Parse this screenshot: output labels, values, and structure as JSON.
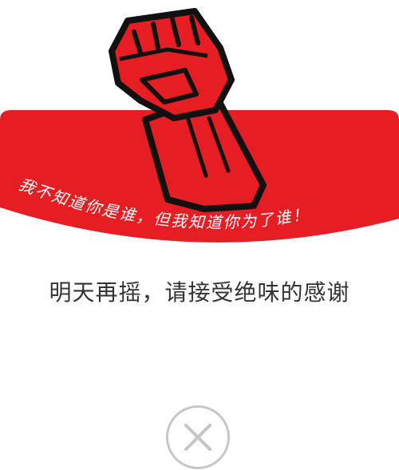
{
  "banner": {
    "slogan": "我不知道你是谁，但我知道你为了谁！",
    "bg_color": "#e61e24",
    "icon": "raised-fist-icon"
  },
  "message": "明天再摇，请接受绝味的感谢",
  "close_button": {
    "icon": "close-icon",
    "border_color": "#c6c6c6"
  }
}
